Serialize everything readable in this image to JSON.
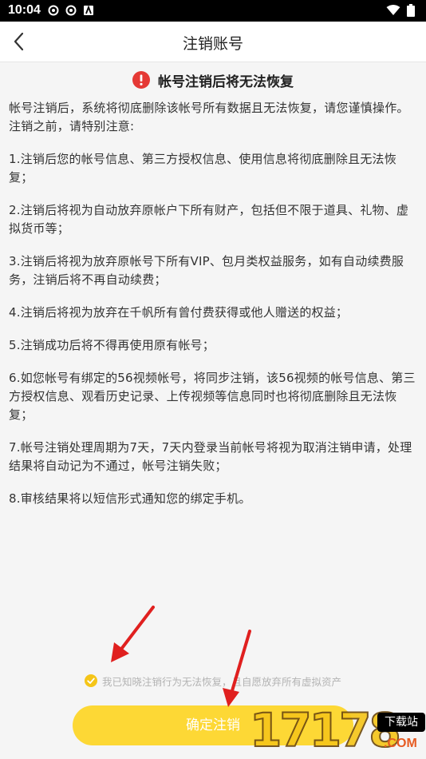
{
  "status_bar": {
    "time": "10:04"
  },
  "nav": {
    "title": "注销账号"
  },
  "warning": {
    "title": "帐号注销后将无法恢复"
  },
  "content": {
    "intro": "帐号注销后，系统将彻底删除该帐号所有数据且无法恢复，请您谨慎操作。注销之前，请特别注意:",
    "items": [
      "1.注销后您的帐号信息、第三方授权信息、使用信息将彻底删除且无法恢复；",
      "2.注销后将视为自动放弃原帐户下所有财产，包括但不限于道具、礼物、虚拟货币等；",
      "3.注销后将视为放弃原帐号下所有VIP、包月类权益服务，如有自动续费服务，注销后将不再自动续费；",
      "4.注销后将视为放弃在千帆所有曾付费获得或他人赠送的权益；",
      "5.注销成功后将不得再使用原有帐号；",
      "6.如您帐号有绑定的56视频帐号，将同步注销，该56视频的帐号信息、第三方授权信息、观看历史记录、上传视频等信息同时也将彻底删除且无法恢复；",
      "7.帐号注销处理周期为7天，7天内登录当前帐号将视为取消注销申请，处理结果将自动记为不通过，帐号注销失败；",
      "8.审核结果将以短信形式通知您的绑定手机。"
    ]
  },
  "agreement": {
    "label": "我已知晓注销行为无法恢复，且自愿放弃所有虚拟资产",
    "checked": true
  },
  "confirm": {
    "label": "确定注销"
  },
  "watermark": {
    "digits": "17178",
    "badge": "下载站",
    "suffix": ".COM"
  },
  "colors": {
    "accent": "#fdd835",
    "warning": "#e53935",
    "arrow": "#e0201f"
  }
}
